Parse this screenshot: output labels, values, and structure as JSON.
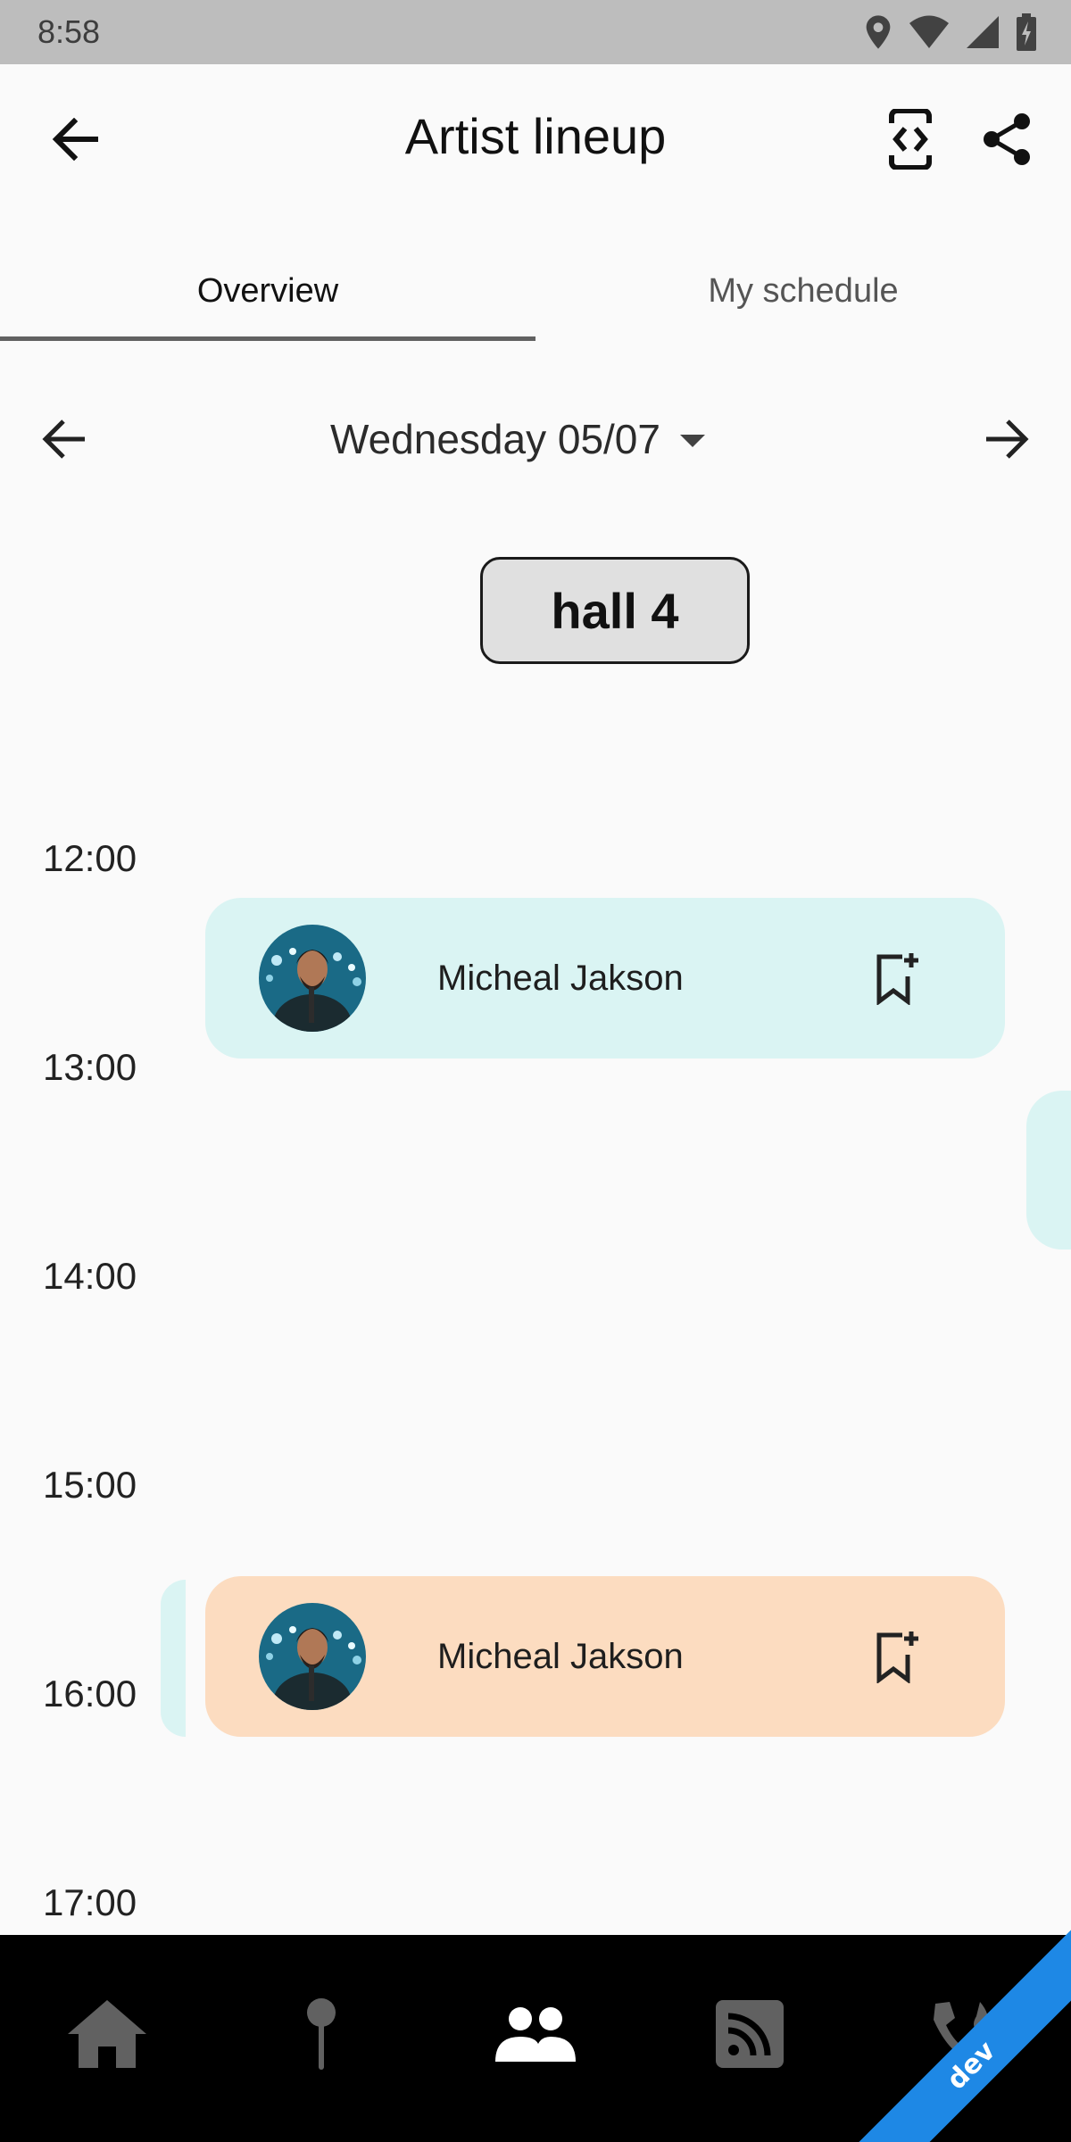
{
  "status_bar": {
    "time": "8:58"
  },
  "app_bar": {
    "title": "Artist lineup"
  },
  "tabs": [
    {
      "label": "Overview",
      "active": true
    },
    {
      "label": "My schedule",
      "active": false
    }
  ],
  "date_nav": {
    "selected_date": "Wednesday 05/07"
  },
  "hall": {
    "label": "hall 4"
  },
  "timeline": {
    "hours": [
      "12:00",
      "13:00",
      "14:00",
      "15:00",
      "16:00",
      "17:00"
    ],
    "events": [
      {
        "artist": "Micheal Jakson",
        "color": "#daf4f3"
      },
      {
        "artist": "Micheal Jakson",
        "color": "#fcdcc0"
      }
    ]
  },
  "bottom_nav": {
    "items": [
      {
        "icon": "home-icon"
      },
      {
        "icon": "map-pin-icon"
      },
      {
        "icon": "people-icon",
        "active": true
      },
      {
        "icon": "rss-feed-icon"
      },
      {
        "icon": "emergency-phone-icon"
      }
    ]
  },
  "ribbon": {
    "label": "dev"
  },
  "colors": {
    "status_bar": "#bdbdbd",
    "background": "#fafafa",
    "card_cyan": "#daf4f3",
    "card_peach": "#fcdcc0",
    "nav_background": "#000000",
    "ribbon": "#1e88e5"
  }
}
